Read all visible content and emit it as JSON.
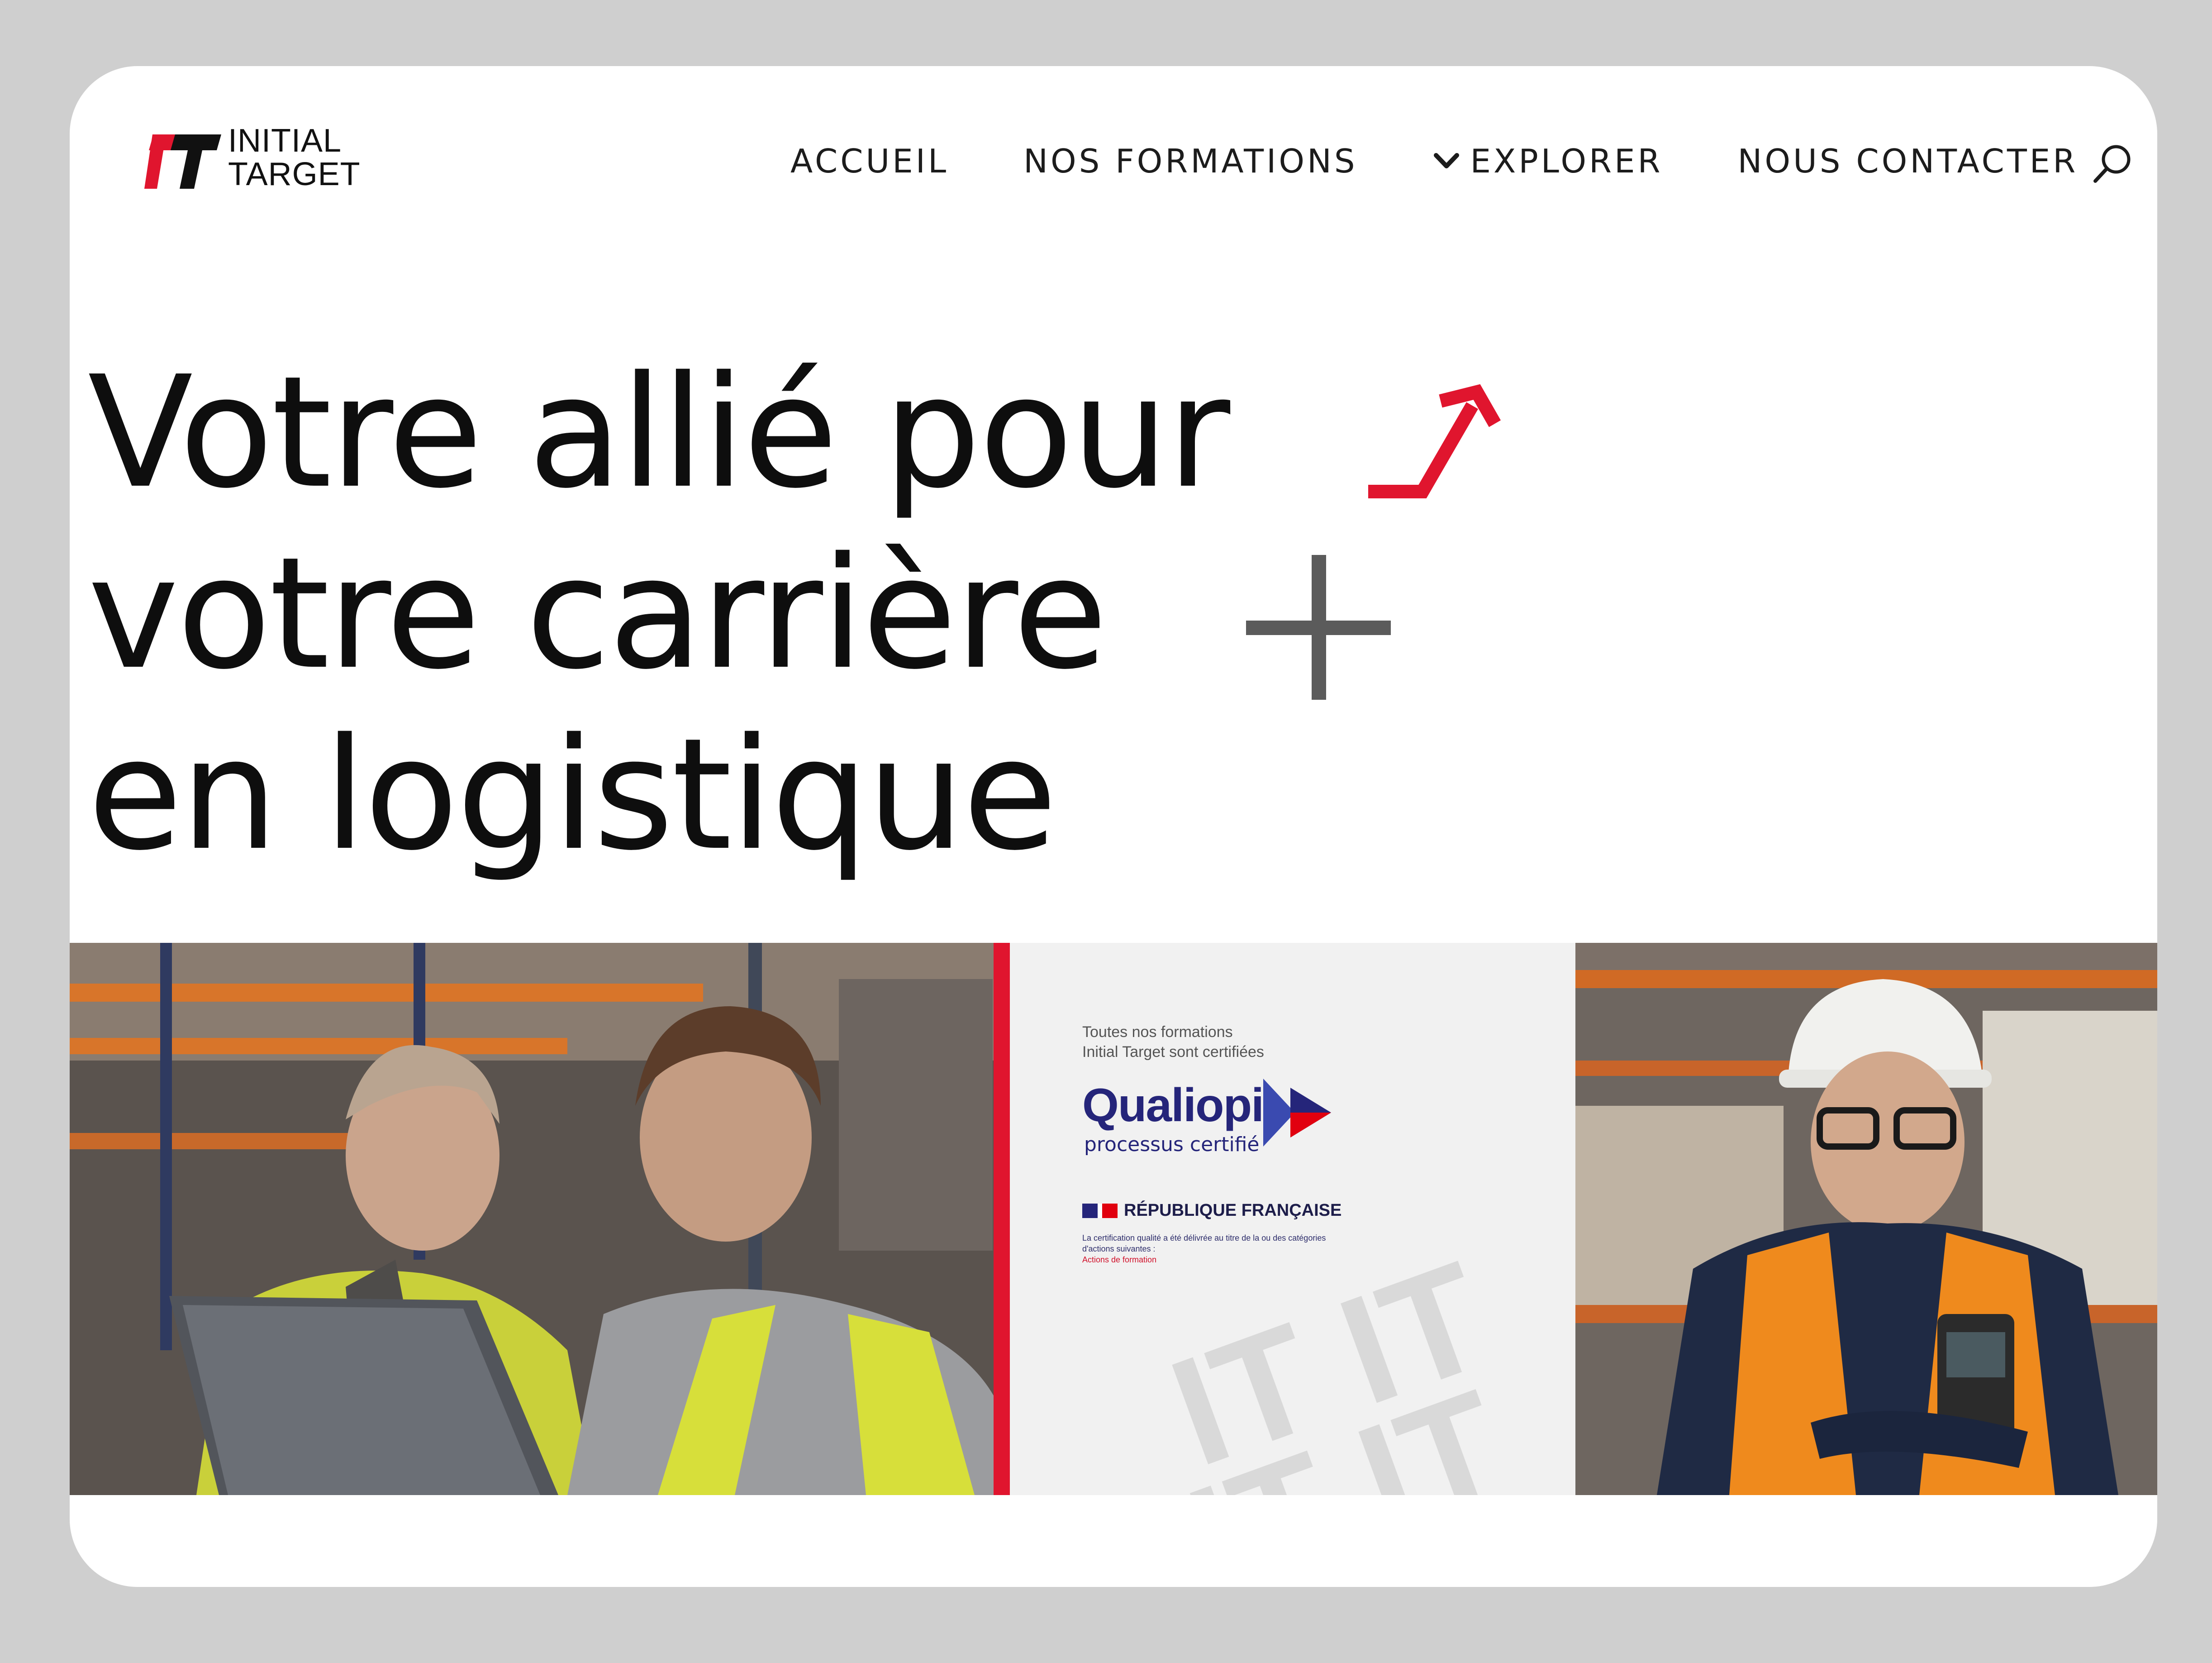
{
  "brand": {
    "logo_line1": "INITIAL",
    "logo_line2": "TARGET",
    "accent_color": "#e0152e"
  },
  "nav": {
    "items": [
      {
        "label": "ACCUEIL"
      },
      {
        "label": "NOS FORMATIONS"
      },
      {
        "label": "EXPLORER",
        "icon": "chevron-down-icon"
      },
      {
        "label": "NOUS CONTACTER"
      }
    ],
    "search_icon": "search-icon"
  },
  "hero": {
    "line1": "Votre allié pour",
    "line2": "votre carrière",
    "line3": "en logistique"
  },
  "certification": {
    "intro_line1": "Toutes nos formations",
    "intro_line2": "Initial Target sont certifiées",
    "brand": "Qualiopi",
    "subtitle": "processus certifié",
    "republic": "RÉPUBLIQUE FRANÇAISE",
    "note": "La certification qualité a été délivrée au titre de la ou des catégories d'actions suivantes :",
    "note_category": "Actions de formation",
    "colors": {
      "navy": "#25257a",
      "red": "#e1000f",
      "blue": "#3a4ab0"
    }
  },
  "photos": {
    "left_alt": "Deux collègues en gilets jaunes consultant un ordinateur portable dans un entrepôt",
    "right_alt": "Cariste souriant avec casque blanc et scanner dans un entrepôt"
  }
}
